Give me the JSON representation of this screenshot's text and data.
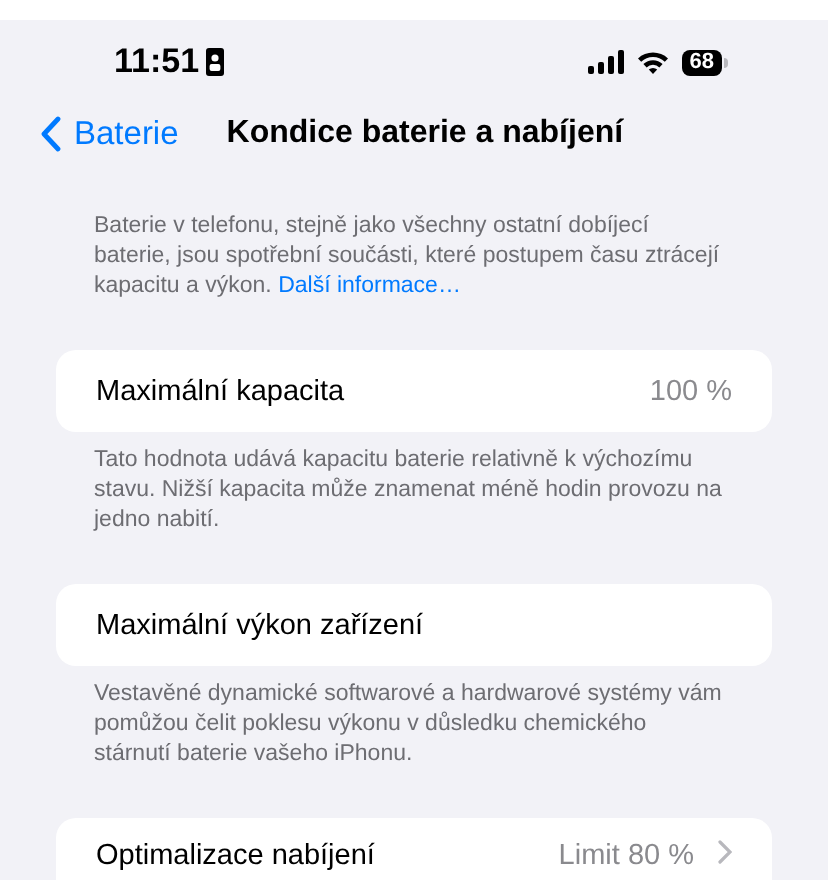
{
  "status_bar": {
    "time": "11:51",
    "battery": "68"
  },
  "nav": {
    "back": "Baterie",
    "title": "Kondice baterie a nabíjení"
  },
  "intro": {
    "text": "Baterie v telefonu, stejně jako všechny ostatní dobíjecí baterie, jsou spotřební součásti, které postupem času ztrácejí kapacitu a výkon.",
    "link": "Další informace…"
  },
  "sections": [
    {
      "label": "Maximální kapacita",
      "value": "100 %",
      "disclosure": false,
      "footer": "Tato hodnota udává kapacitu baterie relativně k výchozímu stavu. Nižší kapacita může znamenat méně hodin provozu na jedno nabití."
    },
    {
      "label": "Maximální výkon zařízení",
      "disclosure": false,
      "footer": "Vestavěné dynamické softwarové a hardwarové systémy vám pomůžou čelit poklesu výkonu v důsledku chemického stárnutí baterie vašeho iPhonu."
    },
    {
      "label": "Optimalizace nabíjení",
      "value": "Limit 80 %",
      "disclosure": true
    }
  ]
}
